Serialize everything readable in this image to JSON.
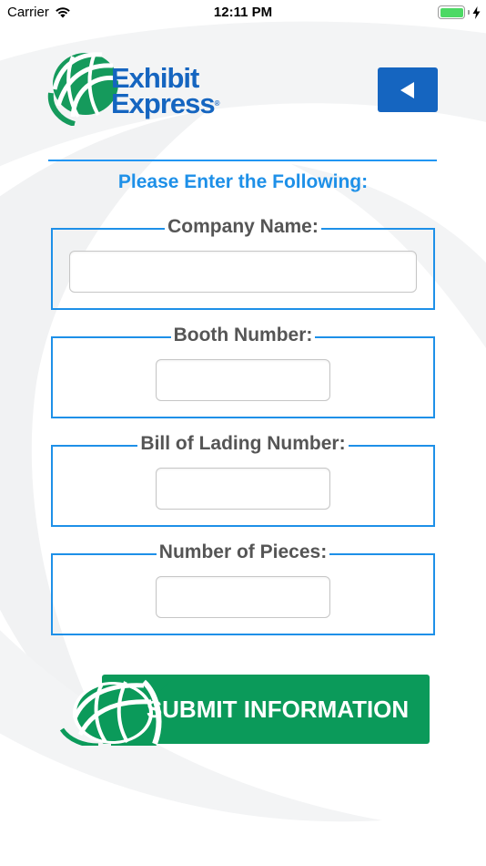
{
  "status_bar": {
    "carrier": "Carrier",
    "time": "12:11 PM"
  },
  "logo": {
    "line1": "Exhibit",
    "line2": "Express",
    "registered": "®"
  },
  "instructions": "Please Enter the Following:",
  "form": {
    "company_name_label": "Company Name:",
    "booth_number_label": "Booth Number:",
    "bill_of_lading_label": "Bill of Lading Number:",
    "number_of_pieces_label": "Number of Pieces:",
    "company_name_value": "",
    "booth_number_value": "",
    "bill_of_lading_value": "",
    "number_of_pieces_value": ""
  },
  "submit_label": "SUBMIT INFORMATION",
  "colors": {
    "brand_blue": "#1565c0",
    "accent_blue": "#1e90e8",
    "brand_green": "#0b9a5a",
    "label_gray": "#555555"
  },
  "icons": {
    "wifi": "wifi-icon",
    "battery": "battery-icon",
    "charging": "charging-bolt-icon",
    "back": "triangle-left-icon",
    "globe": "globe-icon"
  }
}
